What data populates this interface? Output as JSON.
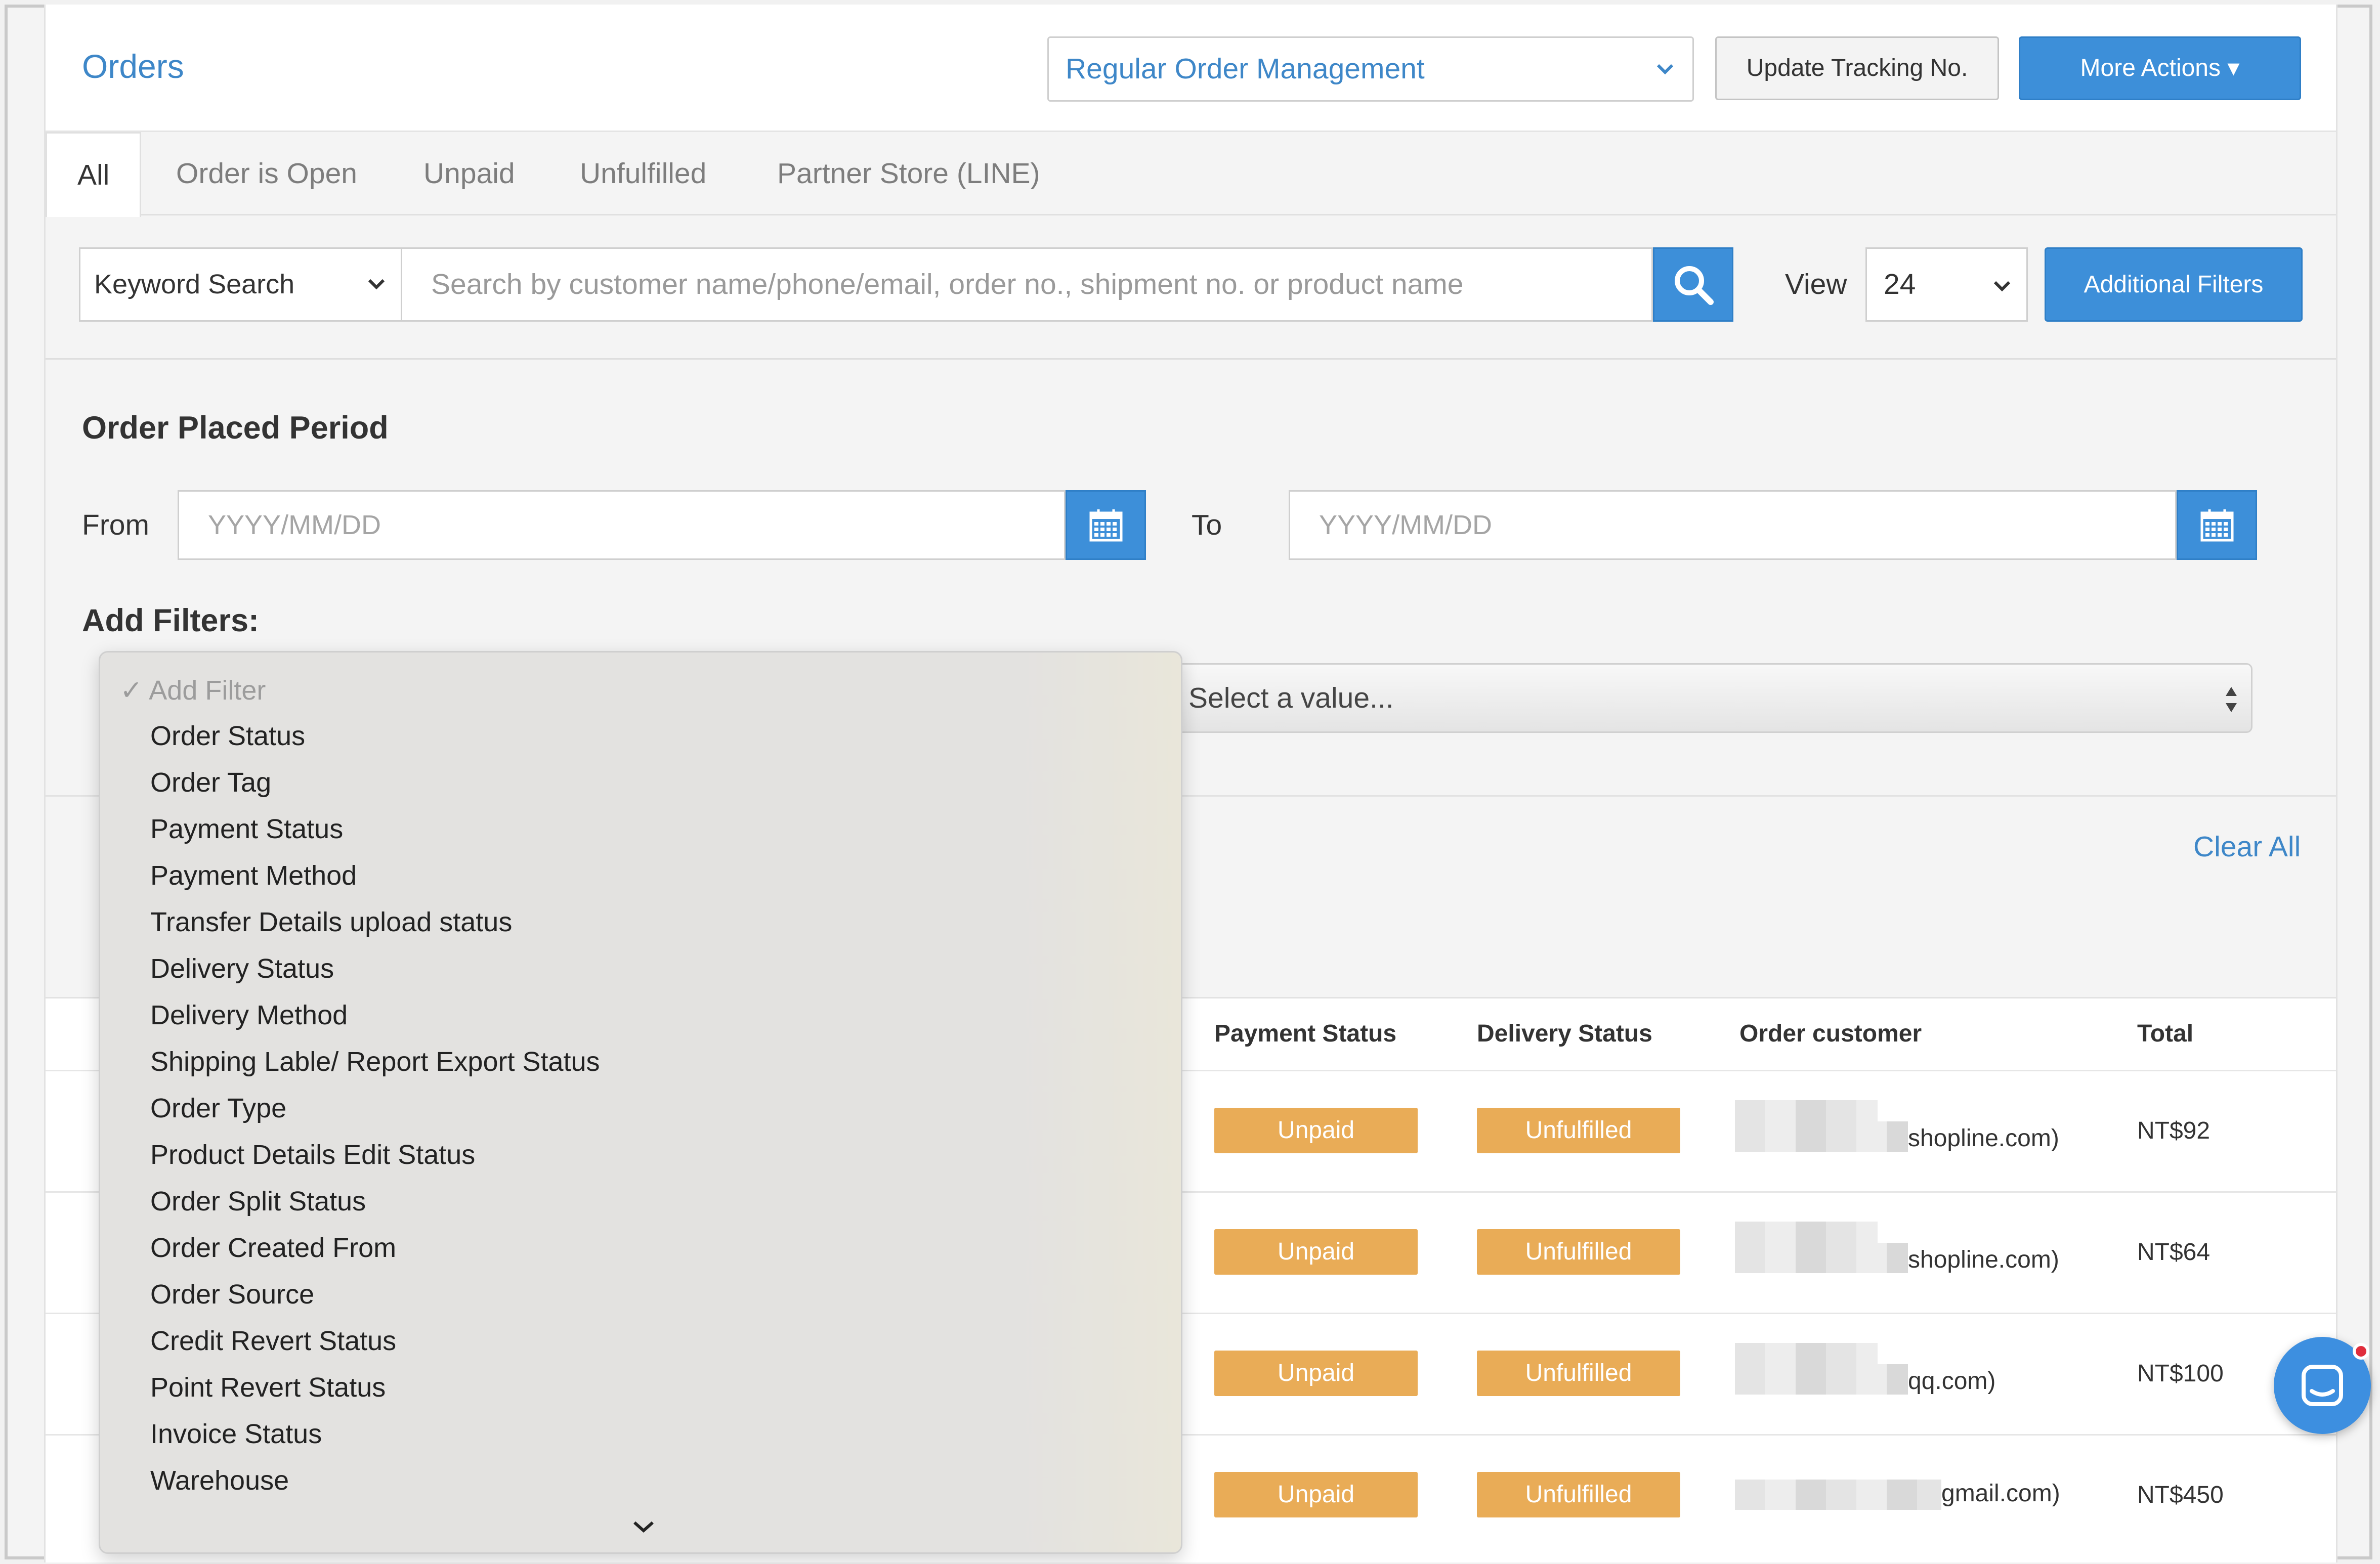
{
  "header": {
    "title": "Orders",
    "management_select": "Regular Order Management",
    "update_tracking_label": "Update Tracking No.",
    "more_actions_label": "More Actions ▾"
  },
  "tabs": [
    {
      "label": "All"
    },
    {
      "label": "Order is Open"
    },
    {
      "label": "Unpaid"
    },
    {
      "label": "Unfulfilled"
    },
    {
      "label": "Partner Store (LINE)"
    }
  ],
  "search": {
    "type_label": "Keyword Search",
    "placeholder": "Search by customer name/phone/email, order no., shipment no. or product name",
    "view_label": "View",
    "view_value": "24",
    "additional_filters_label": "Additional Filters"
  },
  "period": {
    "title": "Order Placed Period",
    "from_label": "From",
    "to_label": "To",
    "date_placeholder": "YYYY/MM/DD"
  },
  "filters": {
    "title": "Add Filters:",
    "value_placeholder": "Select a value...",
    "clear_all_label": "Clear All",
    "dropdown_selected": "Add Filter",
    "options": [
      "Order Status",
      "Order Tag",
      "Payment Status",
      "Payment Method",
      "Transfer Details upload status",
      "Delivery Status",
      "Delivery Method",
      "Shipping Lable/ Report Export Status",
      "Order Type",
      "Product Details Edit Status",
      "Order Split Status",
      "Order Created From",
      "Order Source",
      "Credit Revert Status",
      "Point Revert Status",
      "Invoice Status",
      "Warehouse"
    ]
  },
  "table": {
    "headers": {
      "payment_status": "Payment Status",
      "delivery_status": "Delivery Status",
      "order_customer": "Order customer",
      "total": "Total"
    },
    "rows": [
      {
        "payment": "Unpaid",
        "delivery": "Unfulfilled",
        "email_suffix": "shopline.com)",
        "total": "NT$92"
      },
      {
        "payment": "Unpaid",
        "delivery": "Unfulfilled",
        "email_suffix": "shopline.com)",
        "total": "NT$64"
      },
      {
        "payment": "Unpaid",
        "delivery": "Unfulfilled",
        "email_suffix": "qq.com)",
        "total": "NT$100"
      },
      {
        "payment": "Unpaid",
        "delivery": "Unfulfilled",
        "email_suffix": "gmail.com)",
        "total": "NT$450"
      }
    ]
  },
  "colors": {
    "accent": "#3d8fd9",
    "link": "#3e87c8",
    "badge": "#e9ac57",
    "chat": "#3d8fe0",
    "notification": "#e02d3c"
  },
  "icons": {
    "search": "search-icon",
    "calendar": "calendar-icon",
    "chevron": "chevron-down-icon",
    "chat": "chat-icon"
  }
}
